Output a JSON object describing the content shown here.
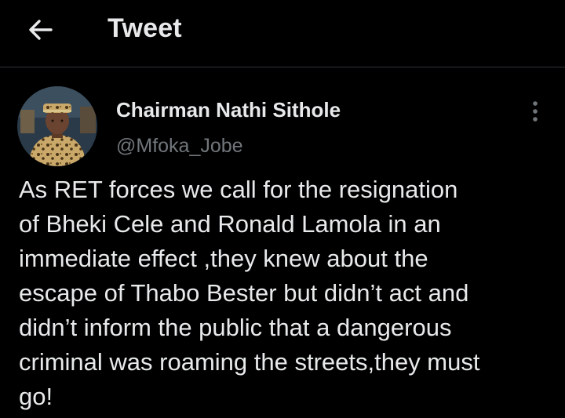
{
  "header": {
    "back_icon": "arrow-left-icon",
    "title": "Tweet"
  },
  "tweet": {
    "author": {
      "name": "Chairman Nathi Sithole",
      "handle": "@Mfoka_Jobe",
      "avatar_icon": "profile-photo"
    },
    "more_icon": "more-vertical-icon",
    "text": "As RET forces we call for the resignation\nof Bheki Cele and Ronald Lamola in an\nimmediate effect ,they knew about the\nescape of Thabo Bester but didn’t act and\ndidn’t inform the public that a dangerous\ncriminal was roaming the streets,they must\ngo!"
  },
  "colors": {
    "background": "#000000",
    "primary_text": "#e7e9ea",
    "secondary_text": "#71767b",
    "divider": "#2f3336"
  }
}
